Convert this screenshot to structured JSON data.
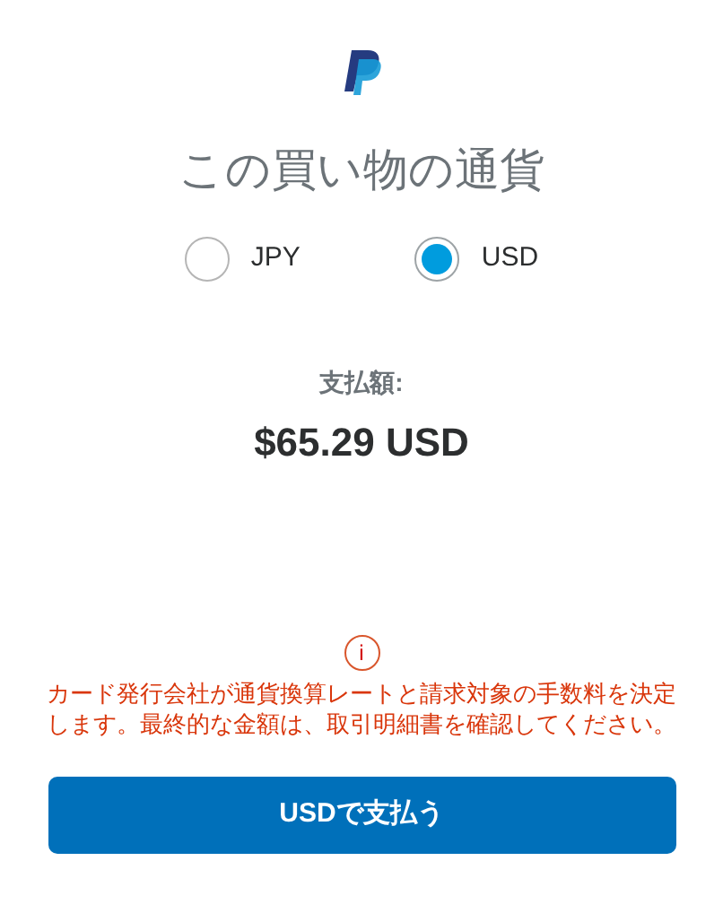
{
  "title": "この買い物の通貨",
  "currencies": [
    {
      "label": "JPY",
      "selected": false
    },
    {
      "label": "USD",
      "selected": true
    }
  ],
  "amount": {
    "label": "支払額:",
    "value": "$65.29 USD"
  },
  "notice": {
    "icon": "i",
    "text": "カード発行会社が通貨換算レートと請求対象の手数料を決定します。最終的な金額は、取引明細書を確認してください。"
  },
  "pay_button": "USDで支払う"
}
